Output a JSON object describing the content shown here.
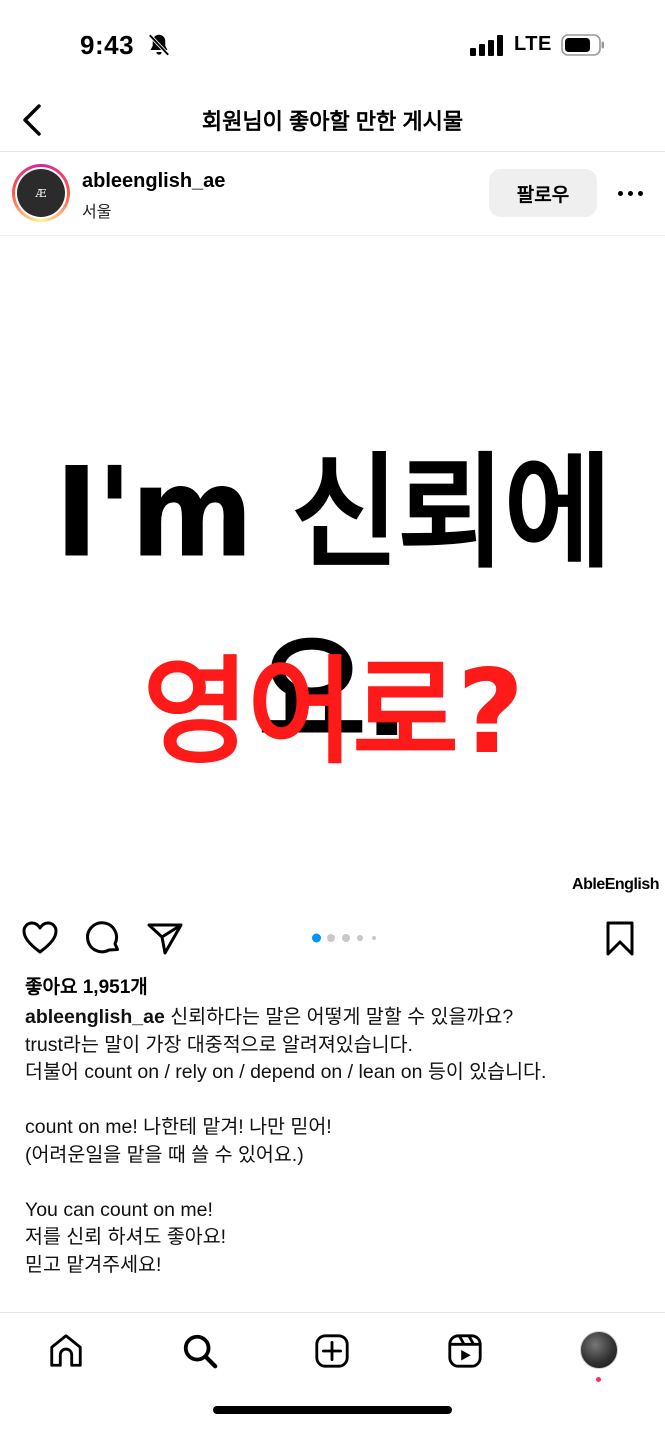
{
  "status_bar": {
    "time": "9:43",
    "network": "LTE",
    "icons": [
      "bell-slash-icon",
      "signal-icon",
      "battery-icon"
    ]
  },
  "header": {
    "title": "회원님이 좋아할 만한 게시물",
    "back_icon": "chevron-left-icon"
  },
  "post": {
    "username": "ableenglish_ae",
    "location": "서울",
    "avatar_text": "Æ",
    "follow_label": "팔로우",
    "image": {
      "line1": "I'm 신뢰에요.",
      "line2": "영어로?",
      "brand": "AbleEnglish",
      "line1_color": "#000000",
      "line2_color": "#ff1a1a"
    },
    "carousel": {
      "count": 5,
      "active_index": 0,
      "active_color": "#0095f6"
    },
    "likes": "좋아요 1,951개",
    "caption_username": "ableenglish_ae",
    "caption_lines": [
      "신뢰하다는 말은 어떻게 말할 수 있을까요?",
      "trust라는 말이 가장 대중적으로 알려져있습니다.",
      "더불어 count on / rely on / depend on / lean on 등이 있습니다.",
      "",
      "count on me! 나한테 맡겨! 나만 믿어!",
      "(어려운일을 맡을 때 쓸 수 있어요.)",
      "",
      "You can count on me!",
      "저를 신뢰 하셔도 좋아요!",
      "믿고 맡겨주세요!"
    ]
  },
  "nav": {
    "items": [
      "home-icon",
      "search-icon",
      "create-icon",
      "reels-icon",
      "profile-avatar"
    ],
    "notification_color": "#ff2d55"
  }
}
